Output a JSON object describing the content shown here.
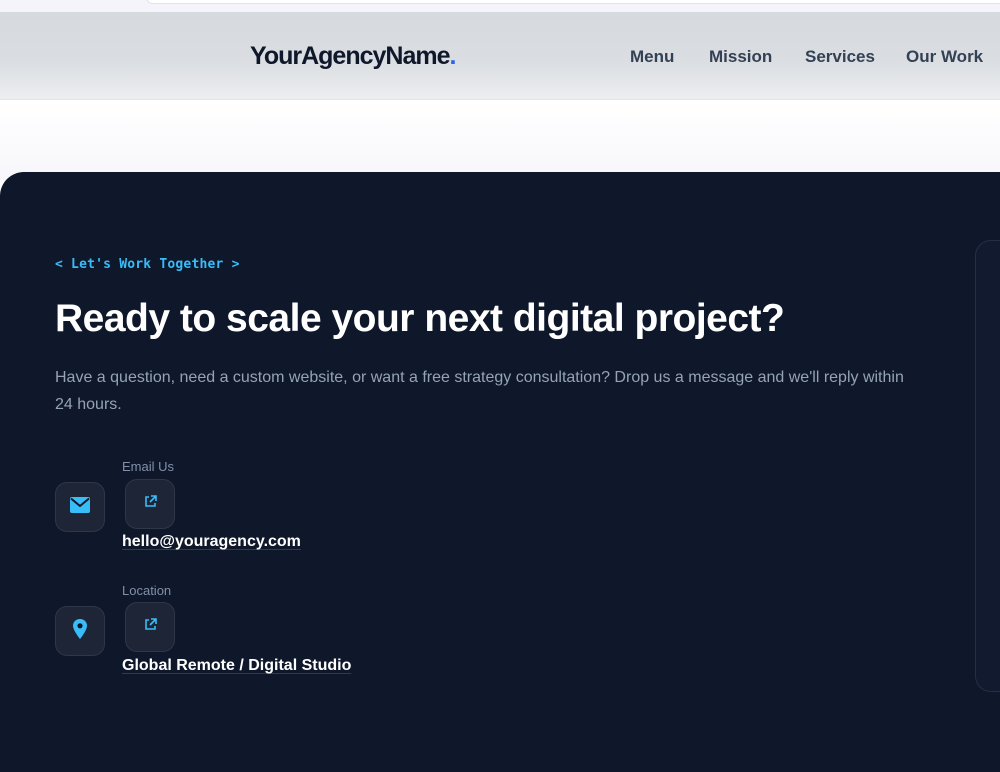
{
  "brand": {
    "name": "YourAgencyName",
    "dot": ".",
    "dot_color": "#2563eb"
  },
  "nav": {
    "items": [
      "Menu",
      "Mission",
      "Services",
      "Our Work"
    ]
  },
  "contact": {
    "eyebrow": "< Let's Work Together >",
    "headline": "Ready to scale your next digital project?",
    "lead": "Have a question, need a custom website, or want a free strategy consultation? Drop us a message and we'll reply within 24 hours.",
    "items": [
      {
        "icon": "envelope-icon",
        "label": "Email Us",
        "value": "hello@youragency.com",
        "action_icon": "external-link-icon"
      },
      {
        "icon": "map-pin-icon",
        "label": "Location",
        "value": "Global Remote / Digital Studio",
        "action_icon": "external-link-icon"
      }
    ]
  },
  "colors": {
    "dark_bg": "#0f172a",
    "accent": "#38bdf8",
    "muted": "#94a3b8"
  }
}
